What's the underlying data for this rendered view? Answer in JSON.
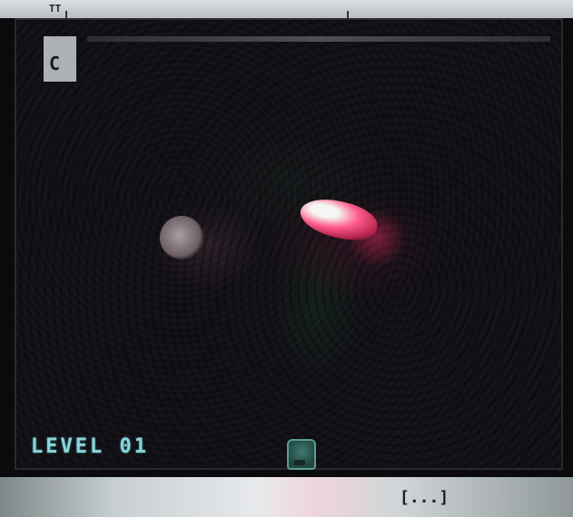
{
  "window": {
    "top_text": "TT"
  },
  "hud": {
    "corner_glyph": "C",
    "level_text": "LEVEL 01",
    "bottom_left_text": "",
    "bottom_right_text": "[...]"
  },
  "colors": {
    "level_text": "#8fd3d8",
    "player_blob": "#ff5d8c",
    "background": "#0b0a0d"
  },
  "icons": [
    "hud-block-icon",
    "player-blob",
    "enemy-blob",
    "status-icon"
  ]
}
